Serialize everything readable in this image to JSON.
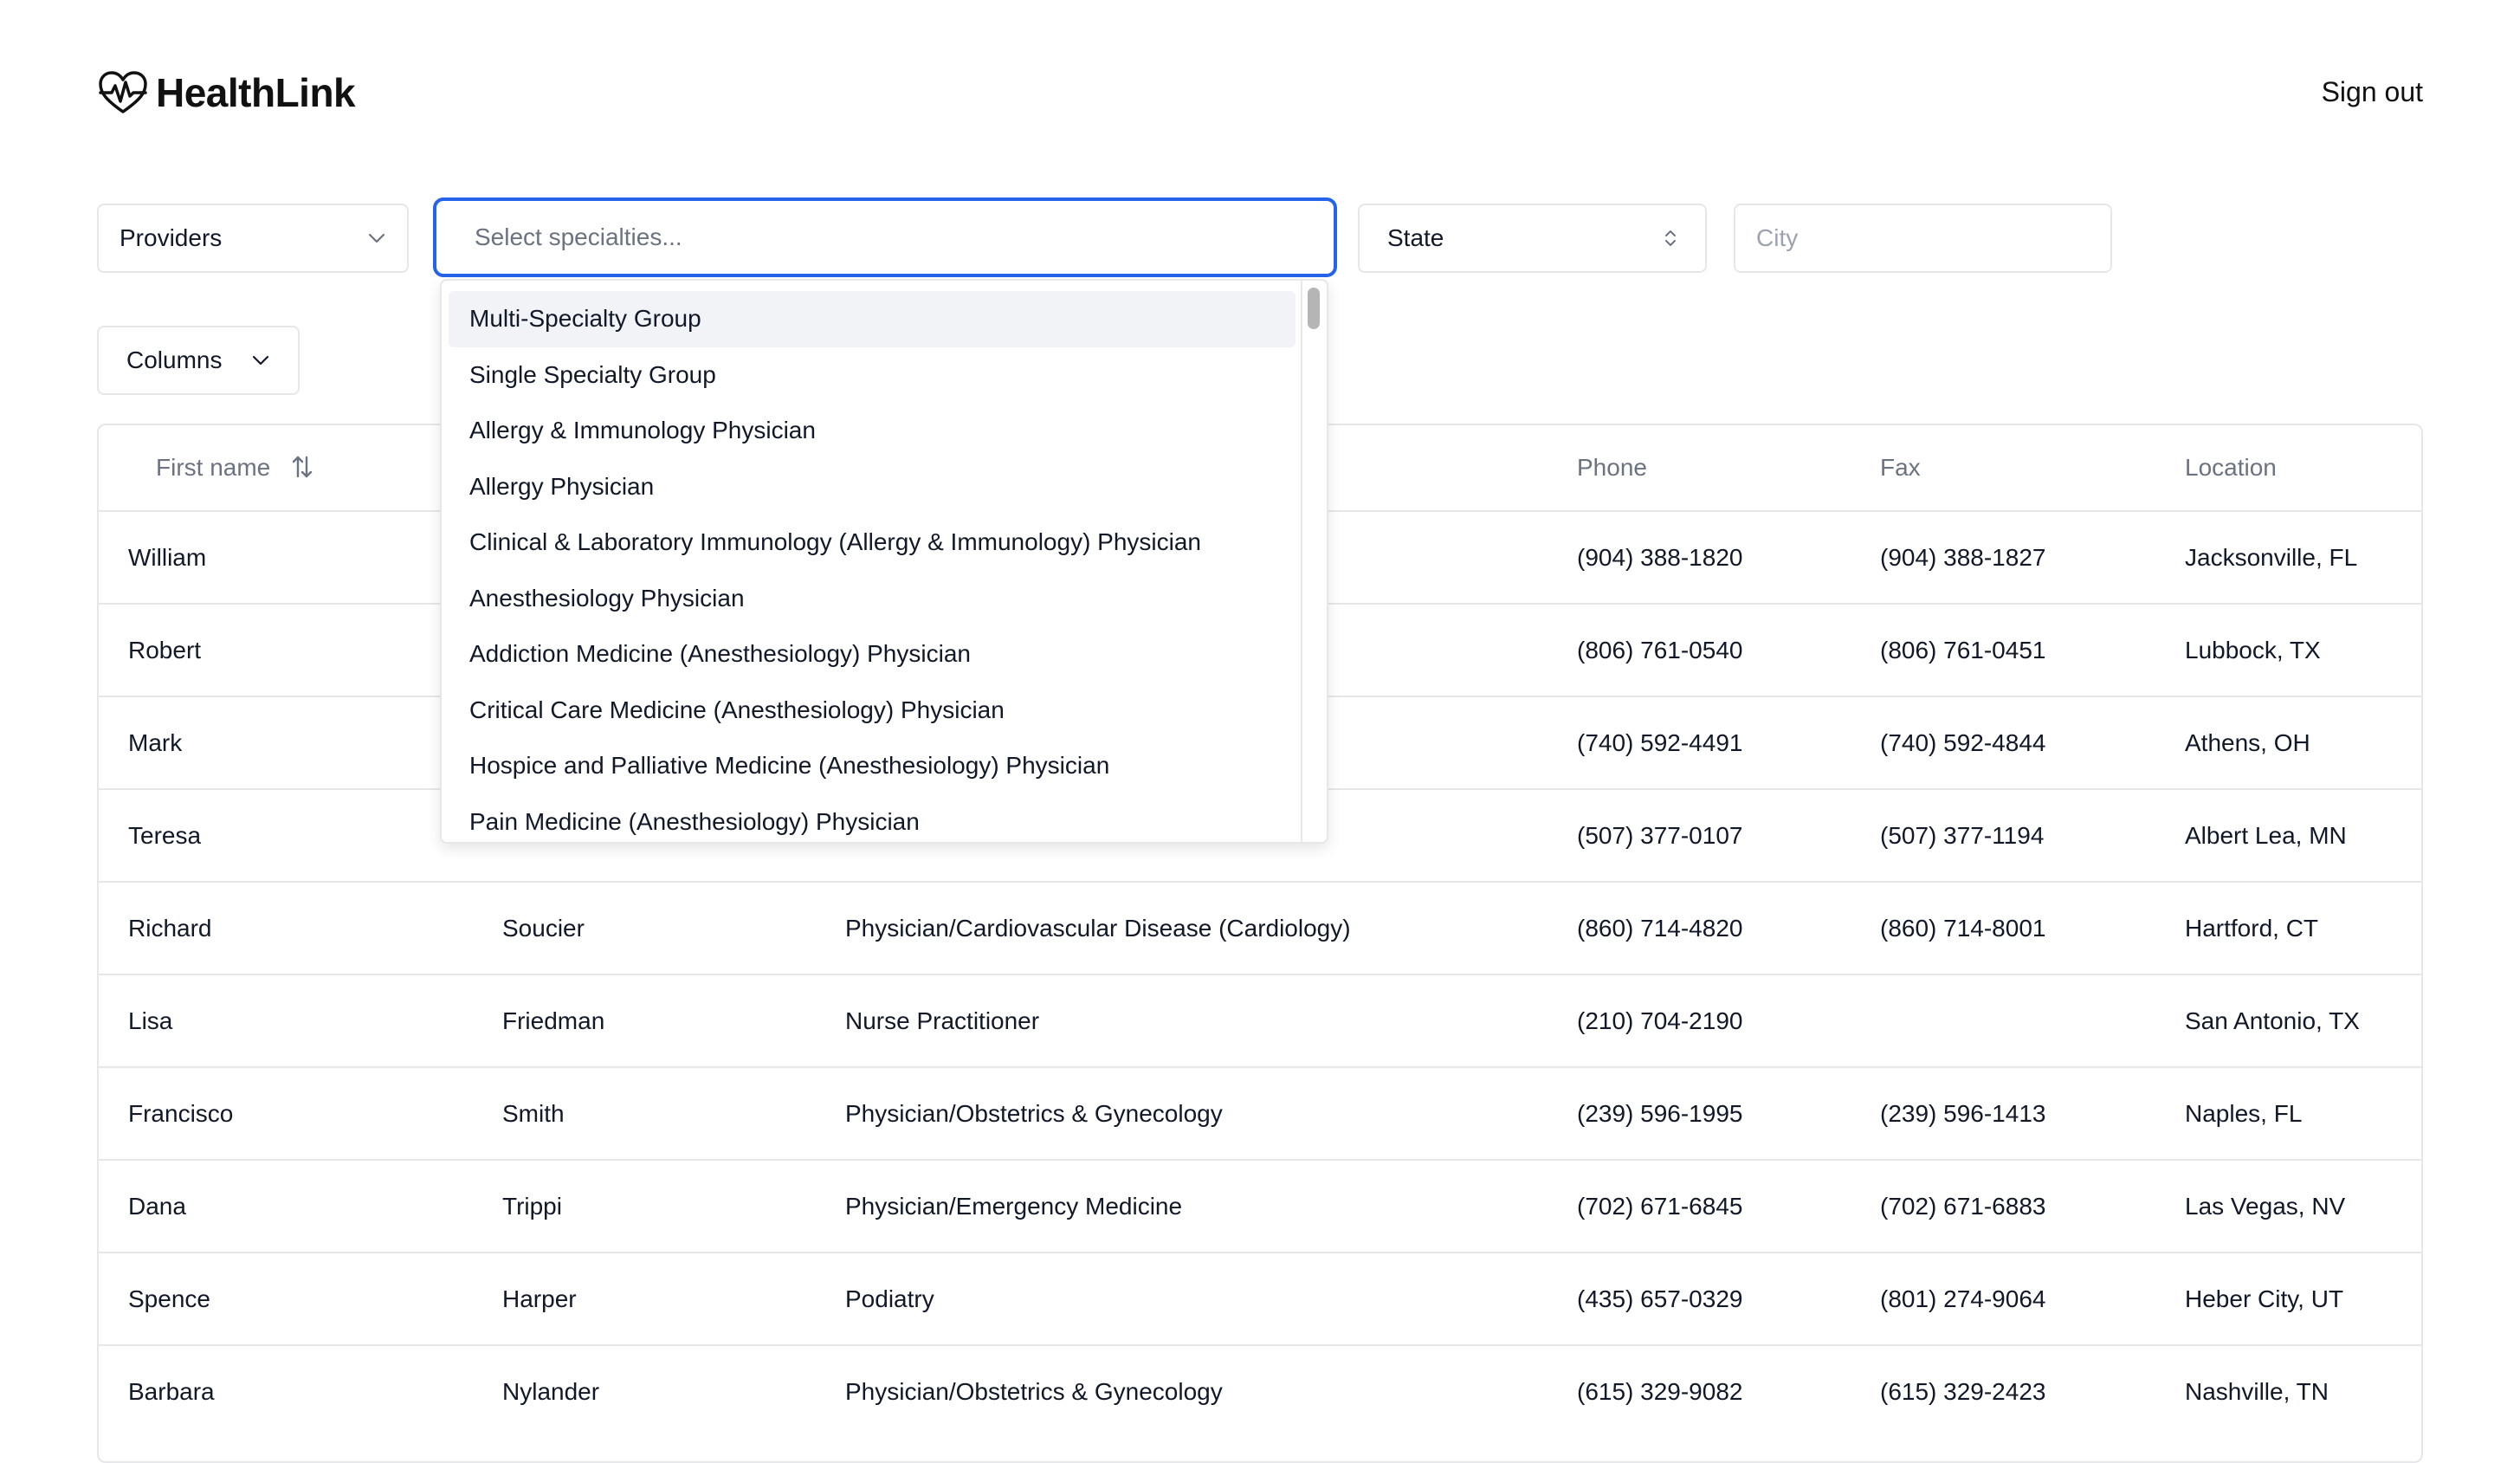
{
  "app": {
    "name": "HealthLink",
    "signout_label": "Sign out"
  },
  "filters": {
    "type_value": "Providers",
    "specialties_placeholder": "Select specialties...",
    "state_value": "State",
    "city_placeholder": "City"
  },
  "columns_label": "Columns",
  "dropdown": {
    "options": [
      "Multi-Specialty Group",
      "Single Specialty Group",
      "Allergy & Immunology Physician",
      "Allergy Physician",
      "Clinical & Laboratory Immunology (Allergy & Immunology) Physician",
      "Anesthesiology Physician",
      "Addiction Medicine (Anesthesiology) Physician",
      "Critical Care Medicine (Anesthesiology) Physician",
      "Hospice and Palliative Medicine (Anesthesiology) Physician",
      "Pain Medicine (Anesthesiology) Physician"
    ],
    "highlighted_index": 0
  },
  "table": {
    "headers": [
      "First name",
      "",
      "",
      "Phone",
      "Fax",
      "Location"
    ],
    "rows": [
      [
        "William",
        "",
        ")",
        "(904) 388-1820",
        "(904) 388-1827",
        "Jacksonville, FL"
      ],
      [
        "Robert",
        "",
        "",
        "(806) 761-0540",
        "(806) 761-0451",
        "Lubbock, TX"
      ],
      [
        "Mark",
        "",
        "",
        "(740) 592-4491",
        "(740) 592-4844",
        "Athens, OH"
      ],
      [
        "Teresa",
        "",
        "",
        "(507) 377-0107",
        "(507) 377-1194",
        "Albert Lea, MN"
      ],
      [
        "Richard",
        "Soucier",
        "Physician/Cardiovascular Disease (Cardiology)",
        "(860) 714-4820",
        "(860) 714-8001",
        "Hartford, CT"
      ],
      [
        "Lisa",
        "Friedman",
        "Nurse Practitioner",
        "(210) 704-2190",
        "",
        "San Antonio, TX"
      ],
      [
        "Francisco",
        "Smith",
        "Physician/Obstetrics & Gynecology",
        "(239) 596-1995",
        "(239) 596-1413",
        "Naples, FL"
      ],
      [
        "Dana",
        "Trippi",
        "Physician/Emergency Medicine",
        "(702) 671-6845",
        "(702) 671-6883",
        "Las Vegas, NV"
      ],
      [
        "Spence",
        "Harper",
        "Podiatry",
        "(435) 657-0329",
        "(801) 274-9064",
        "Heber City, UT"
      ],
      [
        "Barbara",
        "Nylander",
        "Physician/Obstetrics & Gynecology",
        "(615) 329-9082",
        "(615) 329-2423",
        "Nashville, TN"
      ]
    ]
  },
  "colors": {
    "accent": "#2563eb",
    "border": "#e5e7eb",
    "muted_text": "#6b7280"
  },
  "icons": {
    "logo": "heart-pulse-icon",
    "dropdown": "chevron-down-icon",
    "select": "chevron-up-down-icon",
    "sort": "sort-arrows-icon"
  }
}
